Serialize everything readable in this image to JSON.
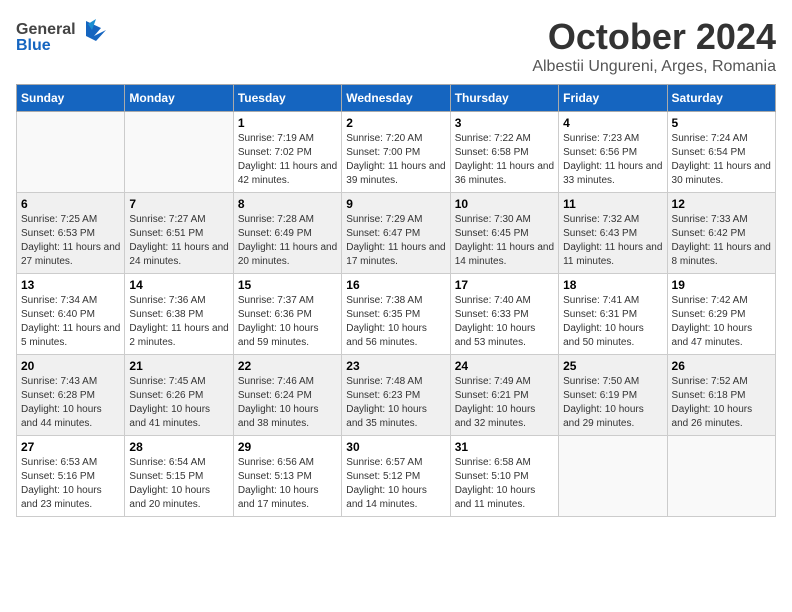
{
  "header": {
    "logo_general": "General",
    "logo_blue": "Blue",
    "month": "October 2024",
    "location": "Albestii Ungureni, Arges, Romania"
  },
  "weekdays": [
    "Sunday",
    "Monday",
    "Tuesday",
    "Wednesday",
    "Thursday",
    "Friday",
    "Saturday"
  ],
  "weeks": [
    [
      {
        "day": "",
        "info": ""
      },
      {
        "day": "",
        "info": ""
      },
      {
        "day": "1",
        "info": "Sunrise: 7:19 AM\nSunset: 7:02 PM\nDaylight: 11 hours and 42 minutes."
      },
      {
        "day": "2",
        "info": "Sunrise: 7:20 AM\nSunset: 7:00 PM\nDaylight: 11 hours and 39 minutes."
      },
      {
        "day": "3",
        "info": "Sunrise: 7:22 AM\nSunset: 6:58 PM\nDaylight: 11 hours and 36 minutes."
      },
      {
        "day": "4",
        "info": "Sunrise: 7:23 AM\nSunset: 6:56 PM\nDaylight: 11 hours and 33 minutes."
      },
      {
        "day": "5",
        "info": "Sunrise: 7:24 AM\nSunset: 6:54 PM\nDaylight: 11 hours and 30 minutes."
      }
    ],
    [
      {
        "day": "6",
        "info": "Sunrise: 7:25 AM\nSunset: 6:53 PM\nDaylight: 11 hours and 27 minutes."
      },
      {
        "day": "7",
        "info": "Sunrise: 7:27 AM\nSunset: 6:51 PM\nDaylight: 11 hours and 24 minutes."
      },
      {
        "day": "8",
        "info": "Sunrise: 7:28 AM\nSunset: 6:49 PM\nDaylight: 11 hours and 20 minutes."
      },
      {
        "day": "9",
        "info": "Sunrise: 7:29 AM\nSunset: 6:47 PM\nDaylight: 11 hours and 17 minutes."
      },
      {
        "day": "10",
        "info": "Sunrise: 7:30 AM\nSunset: 6:45 PM\nDaylight: 11 hours and 14 minutes."
      },
      {
        "day": "11",
        "info": "Sunrise: 7:32 AM\nSunset: 6:43 PM\nDaylight: 11 hours and 11 minutes."
      },
      {
        "day": "12",
        "info": "Sunrise: 7:33 AM\nSunset: 6:42 PM\nDaylight: 11 hours and 8 minutes."
      }
    ],
    [
      {
        "day": "13",
        "info": "Sunrise: 7:34 AM\nSunset: 6:40 PM\nDaylight: 11 hours and 5 minutes."
      },
      {
        "day": "14",
        "info": "Sunrise: 7:36 AM\nSunset: 6:38 PM\nDaylight: 11 hours and 2 minutes."
      },
      {
        "day": "15",
        "info": "Sunrise: 7:37 AM\nSunset: 6:36 PM\nDaylight: 10 hours and 59 minutes."
      },
      {
        "day": "16",
        "info": "Sunrise: 7:38 AM\nSunset: 6:35 PM\nDaylight: 10 hours and 56 minutes."
      },
      {
        "day": "17",
        "info": "Sunrise: 7:40 AM\nSunset: 6:33 PM\nDaylight: 10 hours and 53 minutes."
      },
      {
        "day": "18",
        "info": "Sunrise: 7:41 AM\nSunset: 6:31 PM\nDaylight: 10 hours and 50 minutes."
      },
      {
        "day": "19",
        "info": "Sunrise: 7:42 AM\nSunset: 6:29 PM\nDaylight: 10 hours and 47 minutes."
      }
    ],
    [
      {
        "day": "20",
        "info": "Sunrise: 7:43 AM\nSunset: 6:28 PM\nDaylight: 10 hours and 44 minutes."
      },
      {
        "day": "21",
        "info": "Sunrise: 7:45 AM\nSunset: 6:26 PM\nDaylight: 10 hours and 41 minutes."
      },
      {
        "day": "22",
        "info": "Sunrise: 7:46 AM\nSunset: 6:24 PM\nDaylight: 10 hours and 38 minutes."
      },
      {
        "day": "23",
        "info": "Sunrise: 7:48 AM\nSunset: 6:23 PM\nDaylight: 10 hours and 35 minutes."
      },
      {
        "day": "24",
        "info": "Sunrise: 7:49 AM\nSunset: 6:21 PM\nDaylight: 10 hours and 32 minutes."
      },
      {
        "day": "25",
        "info": "Sunrise: 7:50 AM\nSunset: 6:19 PM\nDaylight: 10 hours and 29 minutes."
      },
      {
        "day": "26",
        "info": "Sunrise: 7:52 AM\nSunset: 6:18 PM\nDaylight: 10 hours and 26 minutes."
      }
    ],
    [
      {
        "day": "27",
        "info": "Sunrise: 6:53 AM\nSunset: 5:16 PM\nDaylight: 10 hours and 23 minutes."
      },
      {
        "day": "28",
        "info": "Sunrise: 6:54 AM\nSunset: 5:15 PM\nDaylight: 10 hours and 20 minutes."
      },
      {
        "day": "29",
        "info": "Sunrise: 6:56 AM\nSunset: 5:13 PM\nDaylight: 10 hours and 17 minutes."
      },
      {
        "day": "30",
        "info": "Sunrise: 6:57 AM\nSunset: 5:12 PM\nDaylight: 10 hours and 14 minutes."
      },
      {
        "day": "31",
        "info": "Sunrise: 6:58 AM\nSunset: 5:10 PM\nDaylight: 10 hours and 11 minutes."
      },
      {
        "day": "",
        "info": ""
      },
      {
        "day": "",
        "info": ""
      }
    ]
  ]
}
